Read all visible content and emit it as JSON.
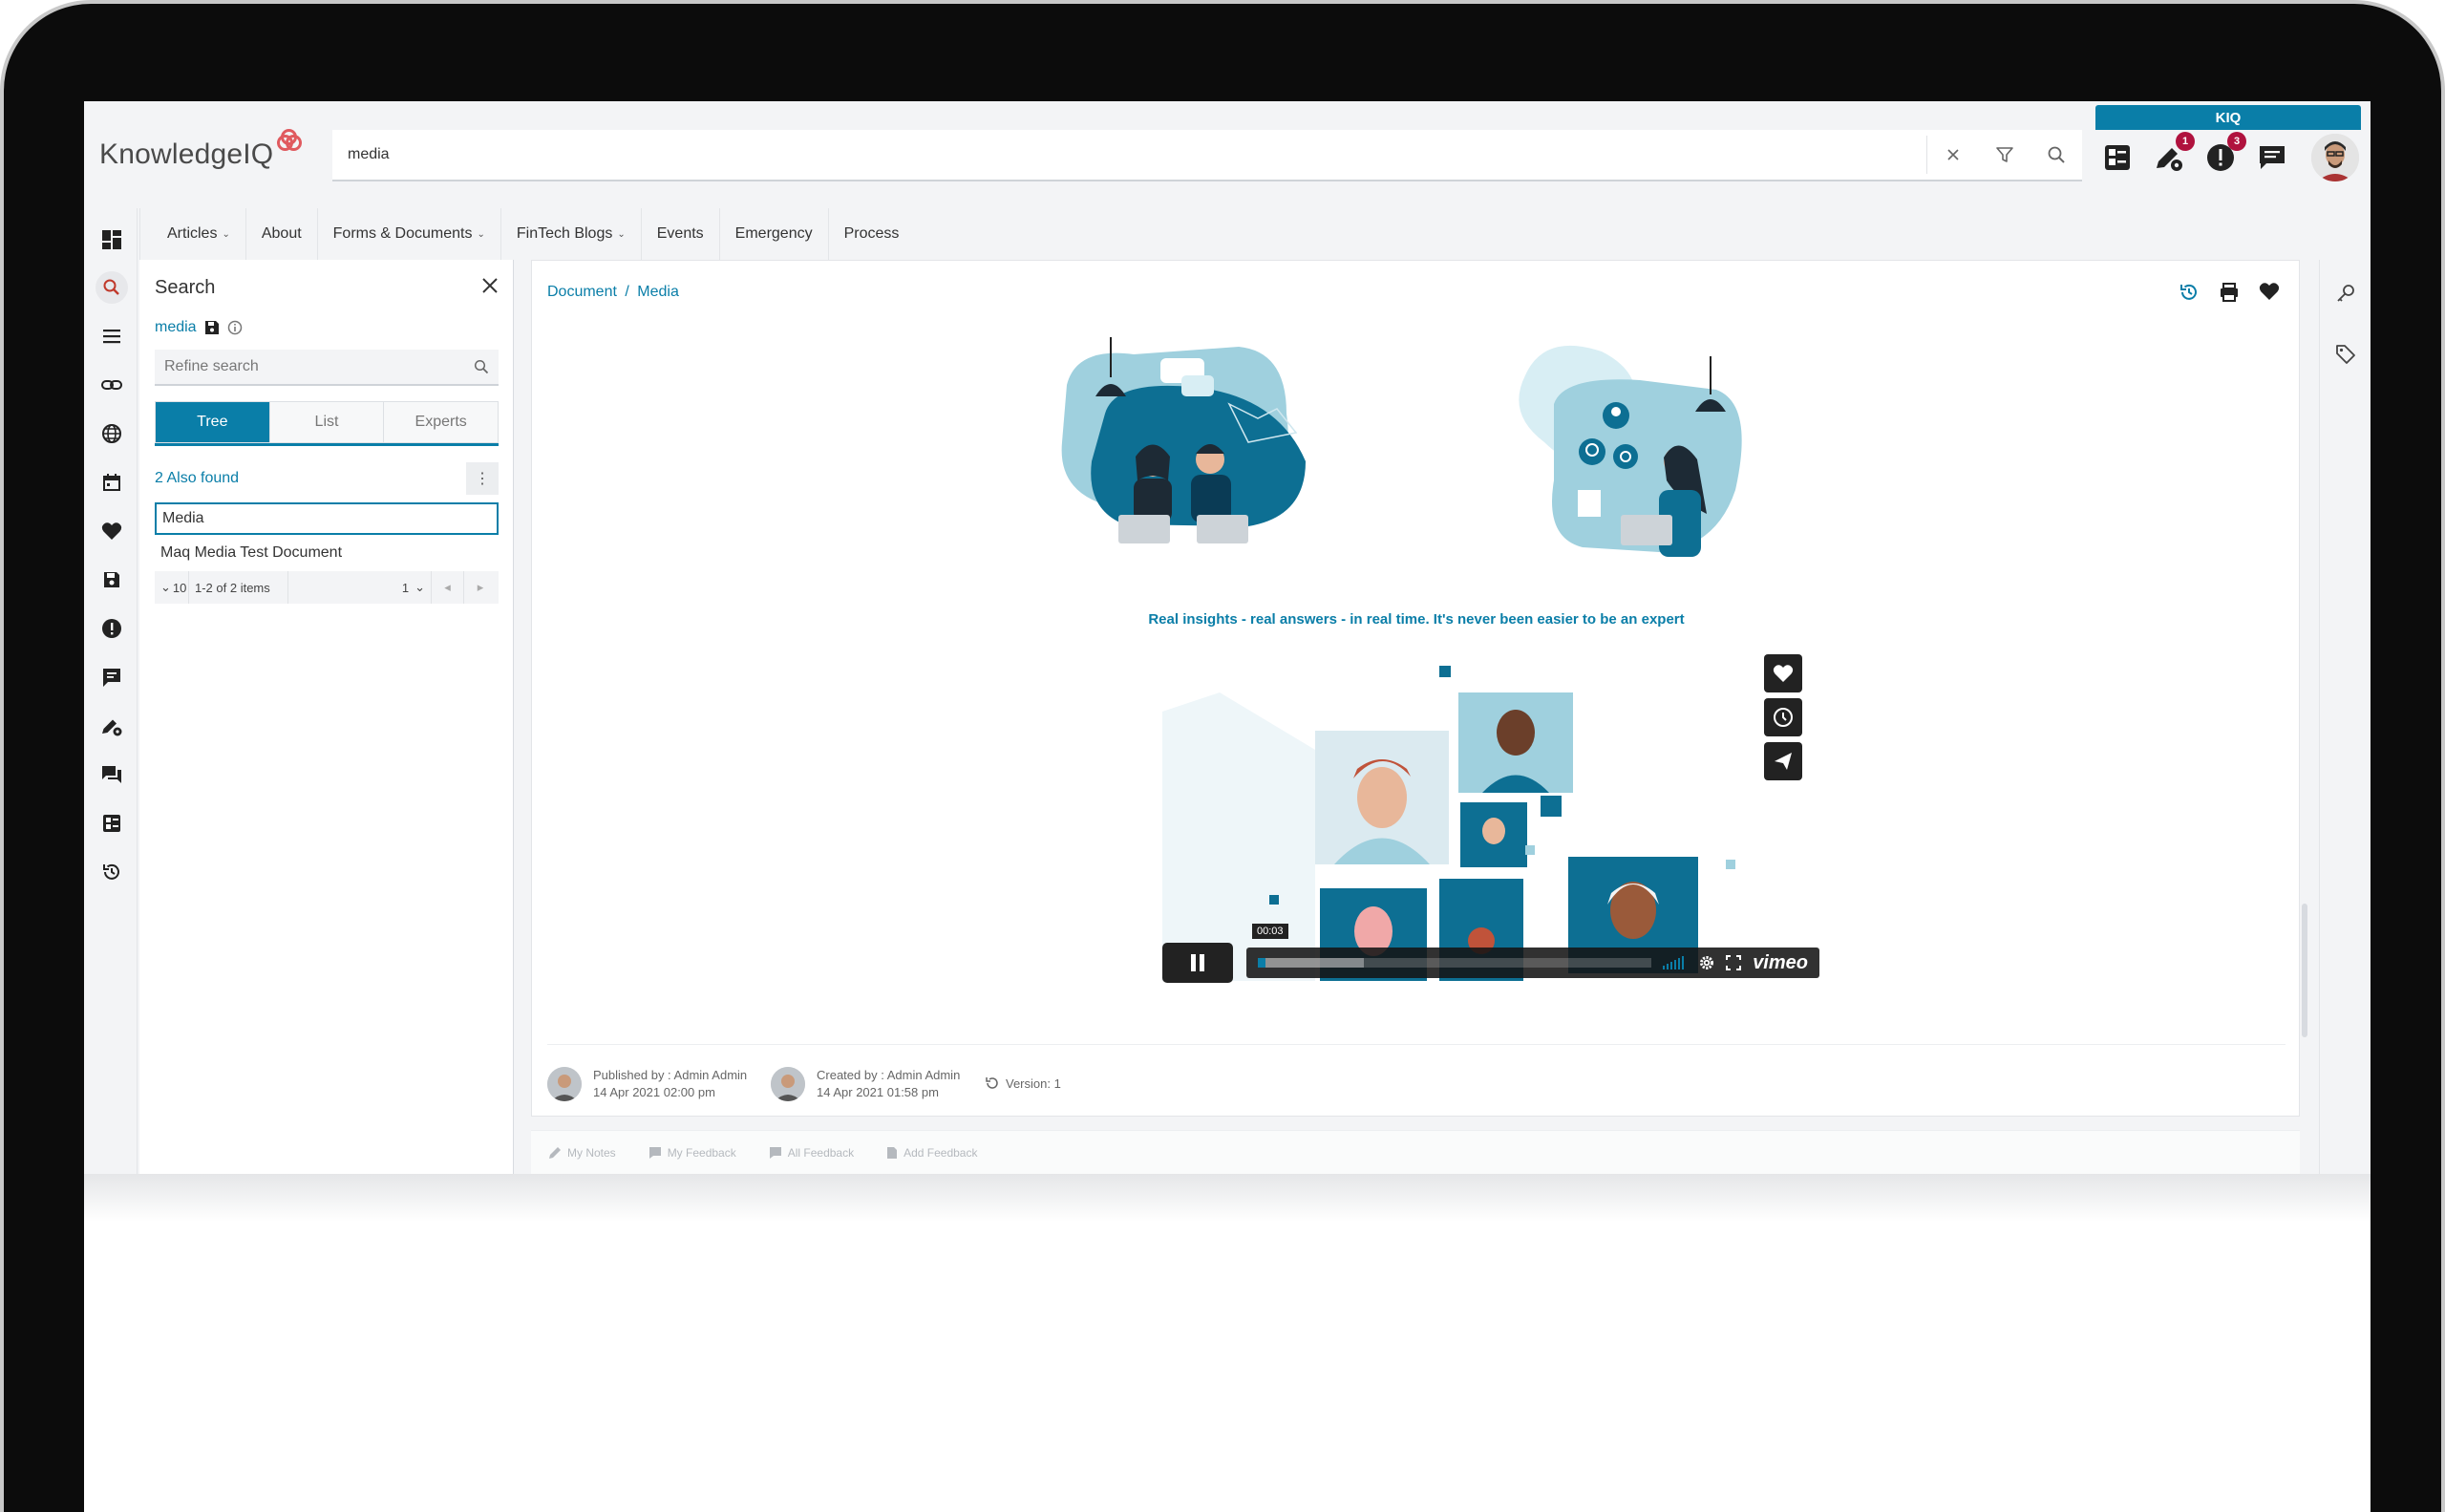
{
  "header": {
    "logo_text": "KnowledgeIQ",
    "search_value": "media",
    "kiq_label": "KIQ",
    "notifications_badge": "1",
    "alerts_badge": "3"
  },
  "nav": {
    "items": [
      "Articles",
      "About",
      "Forms & Documents",
      "FinTech Blogs",
      "Events",
      "Emergency",
      "Process"
    ]
  },
  "search_panel": {
    "title": "Search",
    "query": "media",
    "refine_placeholder": "Refine search",
    "tabs": [
      "Tree",
      "List",
      "Experts"
    ],
    "also_found": "2 Also found",
    "results": [
      "Media",
      "Maq Media Test Document"
    ],
    "pager": {
      "page_size": "10",
      "range": "1-2 of 2 items",
      "page": "1"
    }
  },
  "document": {
    "breadcrumb_root": "Document",
    "breadcrumb_separator": "/",
    "breadcrumb_leaf": "Media",
    "tagline": "Real insights - real answers - in real time. It's never been easier to be an expert",
    "video": {
      "timecode": "00:03",
      "provider": "vimeo",
      "progress": 0.02,
      "buffered": 0.27
    },
    "published_by": "Published by : Admin Admin",
    "published_date": "14 Apr 2021 02:00 pm",
    "created_by": "Created by : Admin Admin",
    "created_date": "14 Apr 2021 01:58 pm",
    "version": "Version: 1"
  },
  "feedback_bar": {
    "items": [
      "My Notes",
      "My Feedback",
      "All Feedback",
      "Add Feedback"
    ]
  },
  "colors": {
    "accent": "#0a7ea8",
    "badge": "#b0123e",
    "illustration_dark": "#0d6f93",
    "illustration_light": "#9fd0de"
  }
}
